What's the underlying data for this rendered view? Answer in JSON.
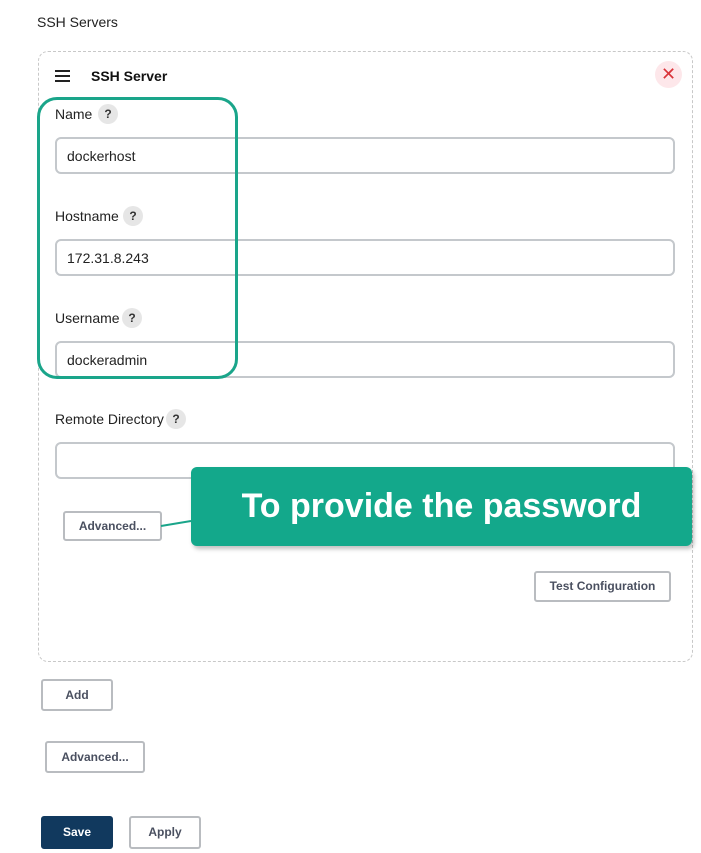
{
  "section": {
    "title": "SSH Servers"
  },
  "server": {
    "title": "SSH Server",
    "delete_icon": "close-x-icon",
    "fields": {
      "name": {
        "label": "Name",
        "value": "dockerhost"
      },
      "hostname": {
        "label": "Hostname",
        "value": "172.31.8.243"
      },
      "username": {
        "label": "Username",
        "value": "dockeradmin"
      },
      "remote_directory": {
        "label": "Remote Directory",
        "value": ""
      }
    },
    "help_glyph": "?",
    "advanced_label": "Advanced...",
    "test_label": "Test Configuration"
  },
  "actions": {
    "add_label": "Add",
    "advanced_label": "Advanced...",
    "save_label": "Save",
    "apply_label": "Apply"
  },
  "annotation": {
    "callout_text": "To provide the password"
  },
  "colors": {
    "accent": "#13a88b",
    "save_button": "#11395e",
    "delete": "#d9343a"
  }
}
